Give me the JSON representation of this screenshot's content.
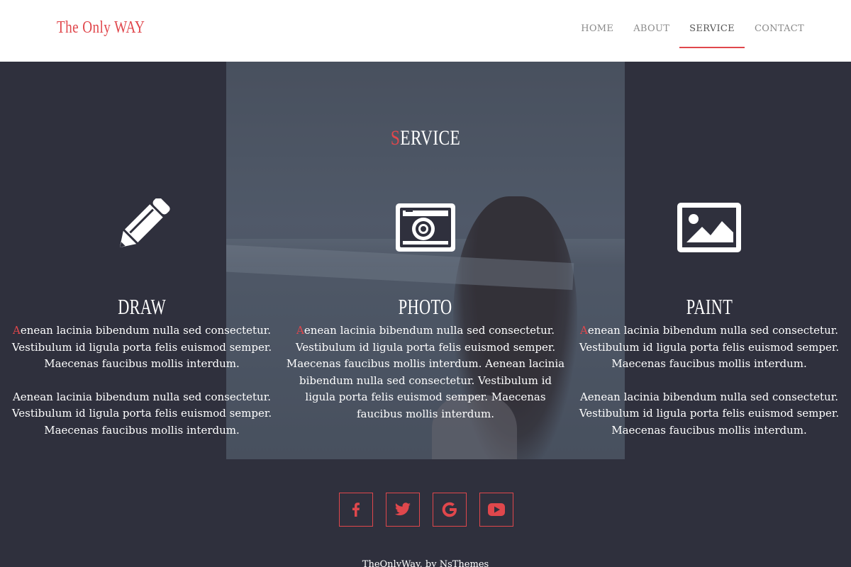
{
  "header": {
    "logo": "The Only WAY",
    "nav": [
      {
        "label": "HOME",
        "active": false
      },
      {
        "label": "ABOUT",
        "active": false
      },
      {
        "label": "SERVICE",
        "active": true
      },
      {
        "label": "CONTACT",
        "active": false
      }
    ]
  },
  "section": {
    "title_first": "S",
    "title_rest": "ERVICE"
  },
  "services": [
    {
      "icon": "pencil-icon",
      "title": "DRAW",
      "p1_first": "A",
      "p1_rest": "enean lacinia bibendum nulla sed consectetur. Vestibulum id ligula porta felis euismod semper. Maecenas faucibus mollis interdum.",
      "p2": "Aenean lacinia bibendum nulla sed consectetur. Vestibulum id ligula porta felis euismod semper. Maecenas faucibus mollis interdum."
    },
    {
      "icon": "camera-icon",
      "title": "PHOTO",
      "p1_first": "A",
      "p1_rest": "enean lacinia bibendum nulla sed consectetur. Vestibulum id ligula porta felis euismod semper. Maecenas faucibus mollis interdum. Aenean lacinia bibendum nulla sed consectetur. Vestibulum id ligula porta felis euismod semper. Maecenas faucibus mollis interdum."
    },
    {
      "icon": "image-icon",
      "title": "PAINT",
      "p1_first": "A",
      "p1_rest": "enean lacinia bibendum nulla sed consectetur. Vestibulum id ligula porta felis euismod semper. Maecenas faucibus mollis interdum.",
      "p2": "Aenean lacinia bibendum nulla sed consectetur. Vestibulum id ligula porta felis euismod semper. Maecenas faucibus mollis interdum."
    }
  ],
  "social": [
    {
      "icon": "facebook-icon"
    },
    {
      "icon": "twitter-icon"
    },
    {
      "icon": "google-icon"
    },
    {
      "icon": "youtube-icon"
    }
  ],
  "footer": {
    "credit": "TheOnlyWay, by NsThemes"
  },
  "colors": {
    "accent": "#e0474c",
    "background": "#2f303d",
    "header_bg": "#ffffff"
  }
}
